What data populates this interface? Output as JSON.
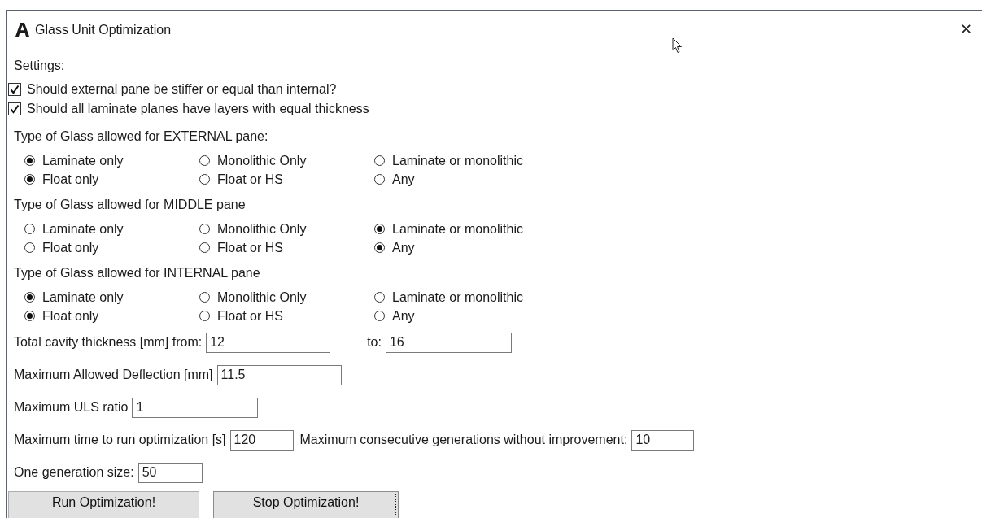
{
  "window": {
    "title": "Glass Unit Optimization",
    "close": "✕"
  },
  "settings_label": "Settings:",
  "checkboxes": [
    {
      "label": "Should external pane be stiffer or equal than internal?",
      "checked": true
    },
    {
      "label": "Should all laminate planes have layers with equal thickness",
      "checked": true
    }
  ],
  "pane_groups": [
    {
      "label": "Type of Glass allowed for EXTERNAL pane:",
      "rows": [
        {
          "options": [
            {
              "label": "Laminate only",
              "selected": true
            },
            {
              "label": "Monolithic Only",
              "selected": false
            },
            {
              "label": "Laminate or monolithic",
              "selected": false
            }
          ]
        },
        {
          "options": [
            {
              "label": "Float only",
              "selected": true
            },
            {
              "label": "Float or HS",
              "selected": false
            },
            {
              "label": "Any",
              "selected": false
            }
          ]
        }
      ]
    },
    {
      "label": "Type of Glass allowed for MIDDLE pane",
      "rows": [
        {
          "options": [
            {
              "label": "Laminate only",
              "selected": false
            },
            {
              "label": "Monolithic Only",
              "selected": false
            },
            {
              "label": "Laminate or monolithic",
              "selected": true
            }
          ]
        },
        {
          "options": [
            {
              "label": "Float only",
              "selected": false
            },
            {
              "label": "Float or HS",
              "selected": false
            },
            {
              "label": "Any",
              "selected": true
            }
          ]
        }
      ]
    },
    {
      "label": "Type of Glass allowed for INTERNAL pane",
      "rows": [
        {
          "options": [
            {
              "label": "Laminate only",
              "selected": true
            },
            {
              "label": "Monolithic Only",
              "selected": false
            },
            {
              "label": "Laminate or monolithic",
              "selected": false
            }
          ]
        },
        {
          "options": [
            {
              "label": "Float only",
              "selected": true
            },
            {
              "label": "Float or HS",
              "selected": false
            },
            {
              "label": "Any",
              "selected": false
            }
          ]
        }
      ]
    }
  ],
  "field_rows": [
    {
      "fields": [
        {
          "label": "Total cavity thickness [mm] from:",
          "value": "12"
        },
        {
          "label": "to:",
          "value": "16"
        }
      ]
    },
    {
      "fields": [
        {
          "label": "Maximum Allowed Deflection [mm]",
          "value": "11.5"
        }
      ]
    },
    {
      "fields": [
        {
          "label": "Maximum ULS ratio",
          "value": "1"
        }
      ]
    },
    {
      "fields": [
        {
          "label": "Maximum time to run optimization [s]",
          "value": "120"
        },
        {
          "label": "Maximum consecutive generations without improvement:",
          "value": "10"
        }
      ]
    },
    {
      "fields": [
        {
          "label": "One generation size:",
          "value": "50"
        }
      ]
    }
  ],
  "buttons": [
    {
      "label": "Run Optimization!",
      "focused": false
    },
    {
      "label": "Stop Optimization!",
      "focused": true
    }
  ]
}
